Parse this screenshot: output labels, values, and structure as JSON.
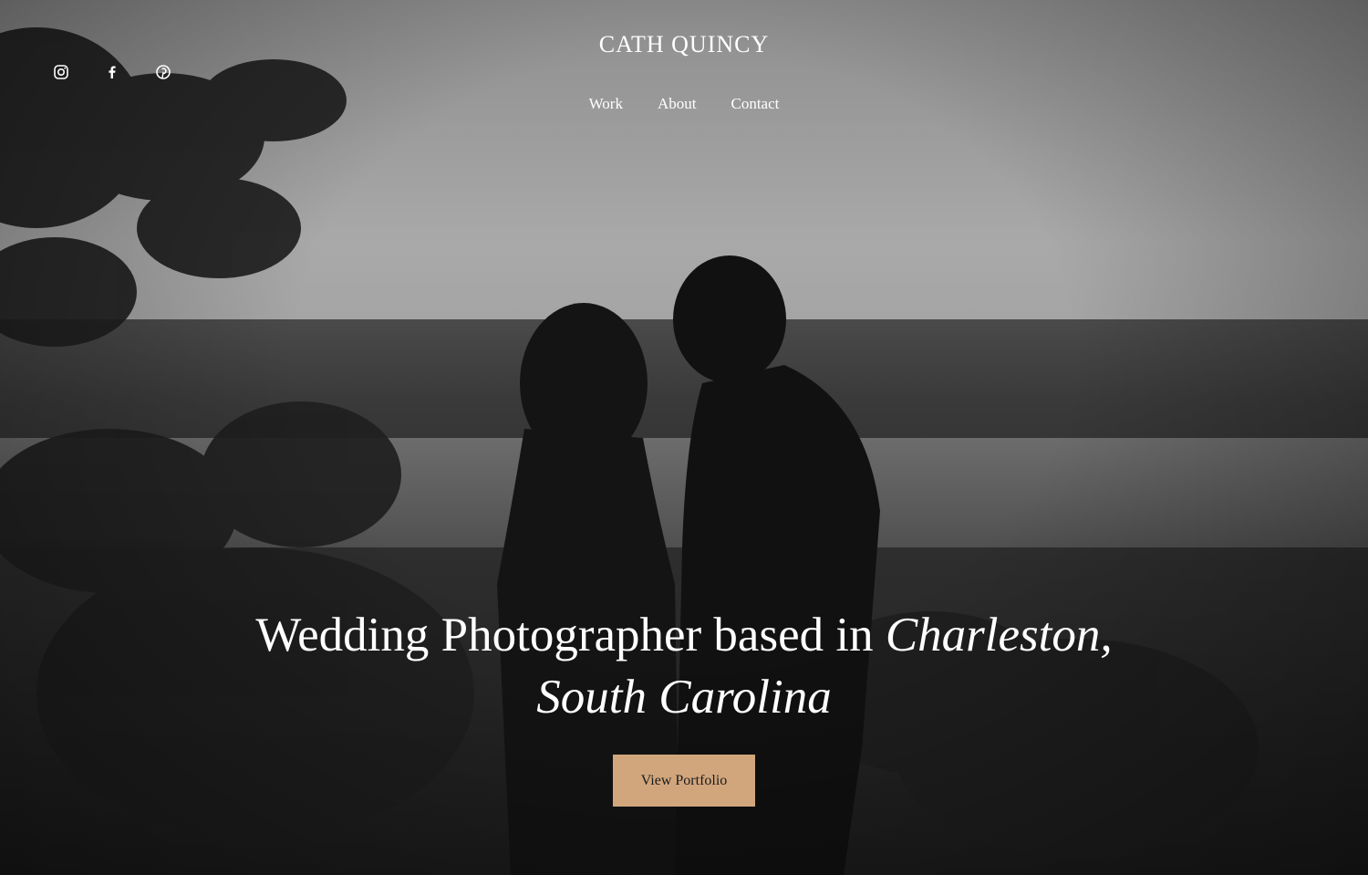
{
  "site": {
    "title": "CATH QUINCY"
  },
  "social": [
    {
      "name": "instagram-icon",
      "label": "Instagram"
    },
    {
      "name": "facebook-icon",
      "label": "Facebook"
    },
    {
      "name": "pinterest-icon",
      "label": "Pinterest"
    }
  ],
  "nav": {
    "items": [
      "Work",
      "About",
      "Contact"
    ]
  },
  "hero": {
    "headline_plain": "Wedding Photographer based in ",
    "headline_italic_1": "Charleston,",
    "headline_italic_2": "South Carolina",
    "cta_label": "View Portfolio"
  },
  "colors": {
    "cta_background": "#d2a67d",
    "text": "#ffffff"
  }
}
